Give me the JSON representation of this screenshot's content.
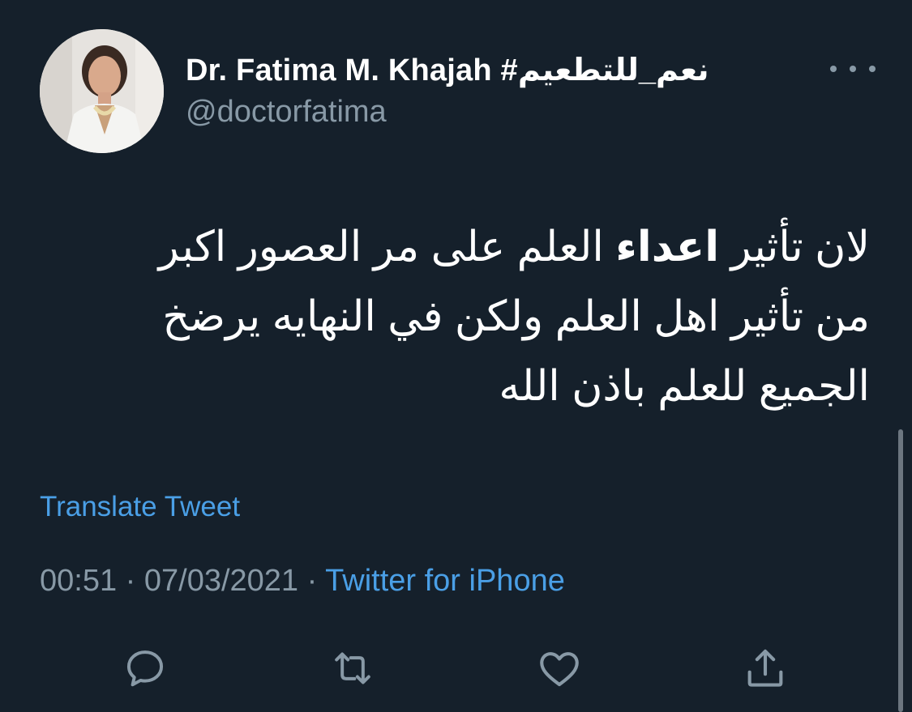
{
  "user": {
    "display_name": "Dr. Fatima M. Khajah #نعم_للتطعيم",
    "handle": "@doctorfatima"
  },
  "tweet": {
    "line1_a": "لان تأثير ",
    "line1_bold": "اعداء",
    "line1_b": " العلم على مر العصور اكبر",
    "line2": "من تأثير اهل العلم ولكن في النهايه يرضخ",
    "line3": "الجميع للعلم باذن الله"
  },
  "translate_label": "Translate Tweet",
  "meta": {
    "time": "00:51",
    "separator1": " · ",
    "date": "07/03/2021",
    "separator2": " · ",
    "source": "Twitter for iPhone"
  },
  "icons": {
    "more": "more-dots-icon",
    "reply": "reply-bubble-icon",
    "retweet": "retweet-icon",
    "like": "heart-icon",
    "share": "share-icon"
  },
  "colors": {
    "background": "#15202b",
    "secondary_text": "#8899a6",
    "link": "#4a9fe6"
  }
}
